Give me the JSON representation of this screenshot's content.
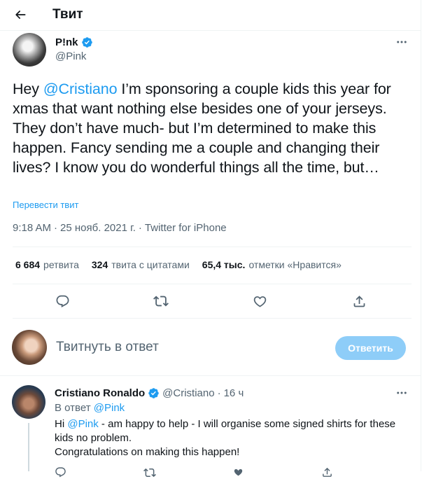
{
  "header": {
    "title": "Твит"
  },
  "tweet": {
    "author_name": "P!nk",
    "author_handle": "@Pink",
    "text_pre": "Hey ",
    "mention": "@Cristiano",
    "text_post": " I’m sponsoring a couple kids this year for xmas that want nothing else besides one of your jerseys. They don’t have much- but I’m determined to make this happen. Fancy sending me a couple and changing their lives? I know you do wonderful things all the time, but…",
    "translate_label": "Перевести твит",
    "time": "9:18 AM",
    "date": "25 нояб. 2021 г.",
    "source": "Twitter for iPhone",
    "separator": "·"
  },
  "stats": {
    "retweets_count": "6 684",
    "retweets_label": "ретвита",
    "quotes_count": "324",
    "quotes_label": "твита с цитатами",
    "likes_count": "65,4 тыс.",
    "likes_label": "отметки «Нравится»"
  },
  "composer": {
    "placeholder": "Твитнуть в ответ",
    "button_label": "Ответить"
  },
  "reply": {
    "author_name": "Cristiano Ronaldo",
    "author_handle": "@Cristiano",
    "separator": "·",
    "time": "16 ч",
    "reply_to_label": "В ответ",
    "reply_to_handle": "@Pink",
    "text_pre": "Hi ",
    "mention": "@Pink",
    "text_line1_post": " - am happy to help - I will organise some signed shirts for these kids no problem.",
    "text_line2": "Congratulations on making this happen!"
  },
  "colors": {
    "accent": "#1d9bf0",
    "button_disabled": "#8ecdf8",
    "secondary_text": "#536471",
    "divider": "#eff3f4"
  },
  "icons": [
    "back-arrow-icon",
    "verified-badge-icon",
    "more-icon",
    "reply-icon",
    "retweet-icon",
    "like-icon",
    "share-icon"
  ]
}
